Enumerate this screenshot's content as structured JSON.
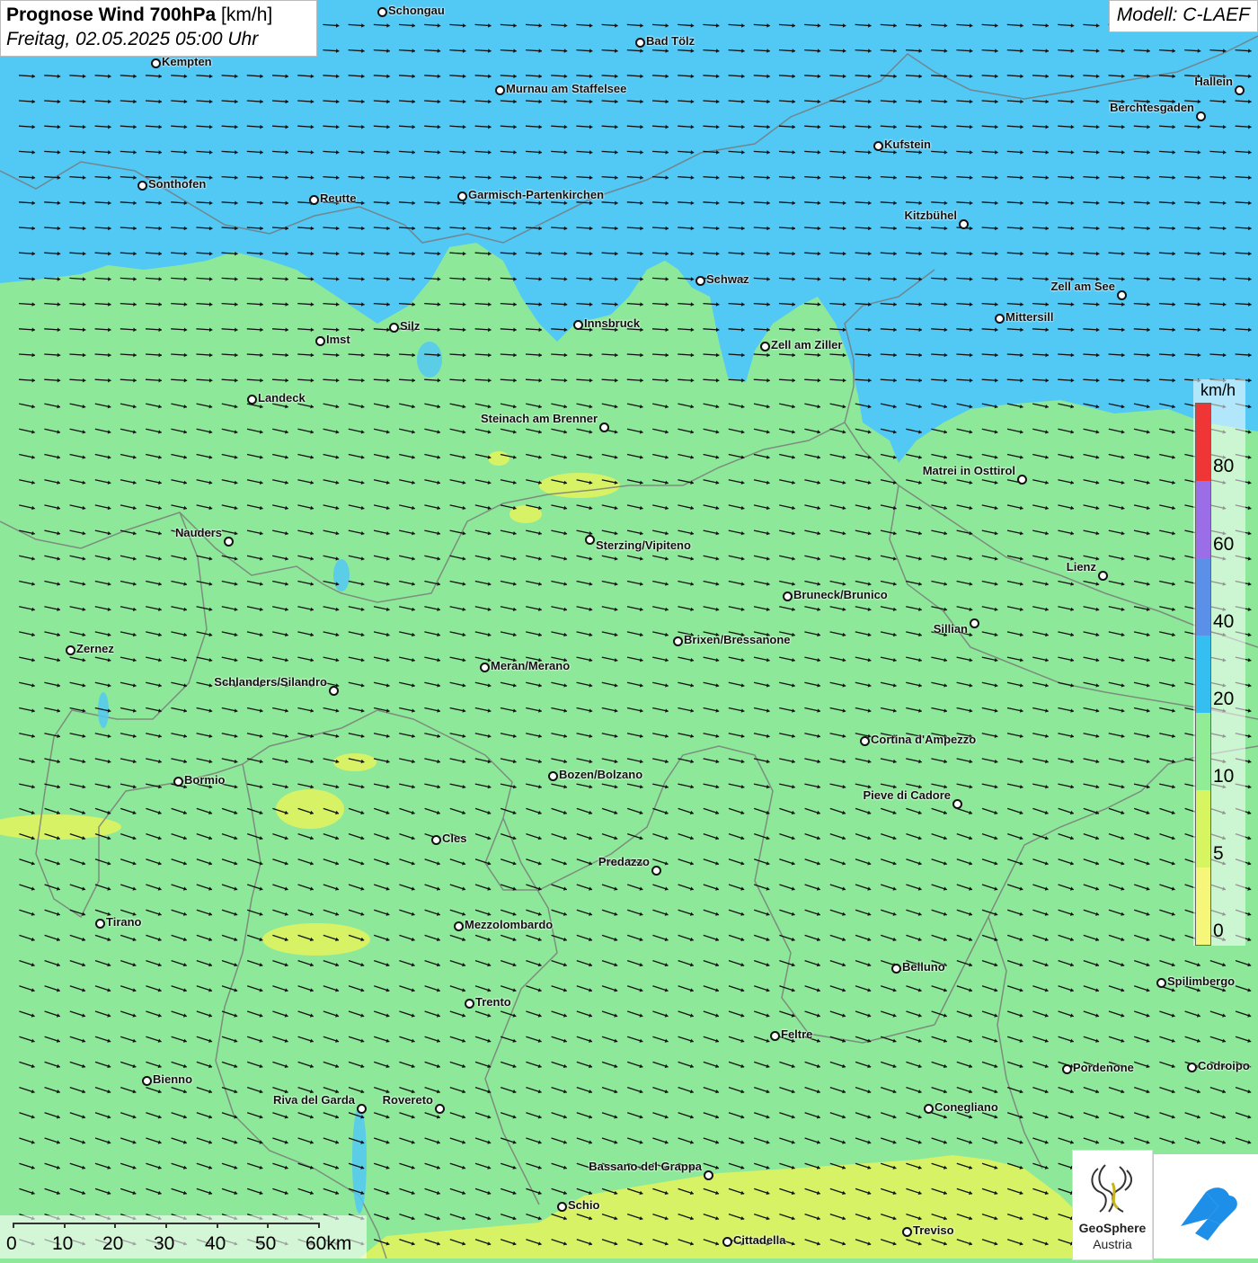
{
  "title": {
    "main": "Prognose Wind 700hPa",
    "unit": "[km/h]",
    "datetime": "Freitag, 02.05.2025 05:00 Uhr"
  },
  "model": "Modell: C-LAEF",
  "legend": {
    "unit": "km/h",
    "labels": [
      "80",
      "60",
      "40",
      "20",
      "10",
      "5",
      "0"
    ],
    "colors": [
      "#ef3535",
      "#9b6ee8",
      "#5a90e8",
      "#35bff0",
      "#90ec95",
      "#d6f560",
      "#f6f67a"
    ]
  },
  "scalebar": {
    "labels": [
      "0",
      "10",
      "20",
      "30",
      "40",
      "50",
      "60km"
    ]
  },
  "logos": {
    "geosphere_line1": "GeoSphere",
    "geosphere_line2": "Austria"
  },
  "colors": {
    "calm_green": "#8ee89a",
    "wind_blue": "#52c8f5",
    "light_wind_yellow": "#d8f266"
  },
  "cities": [
    "Schongau",
    "Bad Tölz",
    "Kempten",
    "Murnau am Staffelsee",
    "Hallein",
    "Berchtesgaden",
    "Kufstein",
    "Sonthofen",
    "Reutte",
    "Garmisch-Partenkirchen",
    "Kitzbühel",
    "Schwaz",
    "Zell am See",
    "Mittersill",
    "Silz",
    "Innsbruck",
    "Imst",
    "Zell am Ziller",
    "Landeck",
    "Steinach am Brenner",
    "Matrei in Osttirol",
    "Nauders",
    "Sterzing/Vipiteno",
    "Lienz",
    "Bruneck/Brunico",
    "Sillian",
    "Zernez",
    "Brixen/Bressanone",
    "Meran/Merano",
    "Schlanders/Silandro",
    "Cortina d'Ampezzo",
    "Bozen/Bolzano",
    "Bormio",
    "Pieve di Cadore",
    "Cles",
    "Predazzo",
    "Tirano",
    "Mezzolombardo",
    "Belluno",
    "Spilimbergo",
    "Trento",
    "Feltre",
    "Pordenone",
    "Codroipo",
    "Bienno",
    "Riva del Garda",
    "Rovereto",
    "Conegliano",
    "Bassano del Grappa",
    "Schio",
    "Treviso",
    "Cittadella"
  ]
}
